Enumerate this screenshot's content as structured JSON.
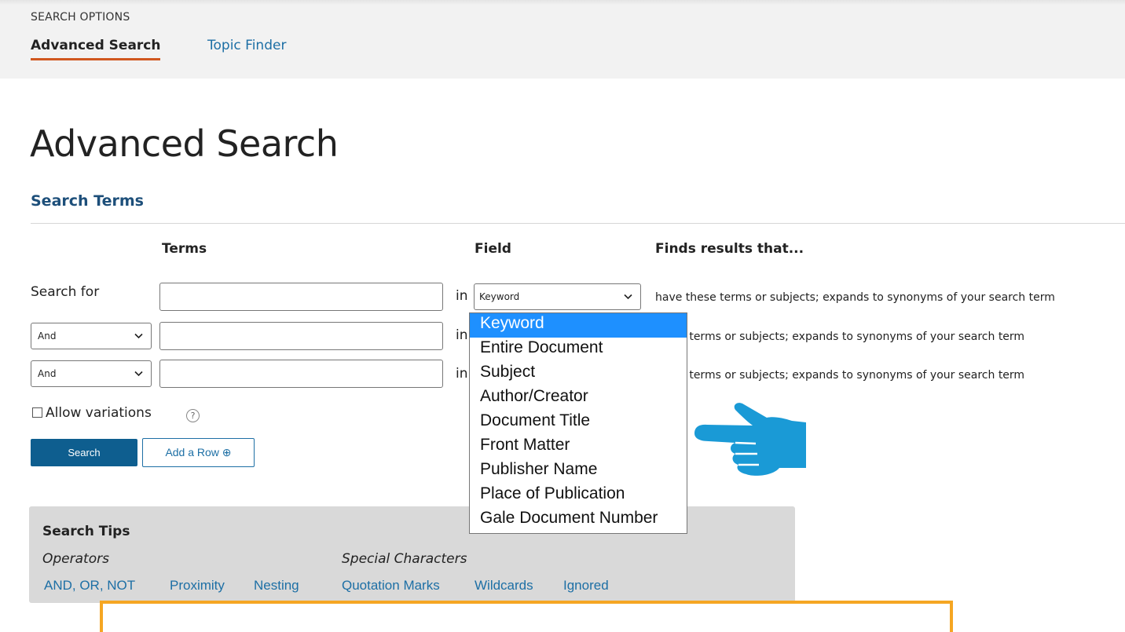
{
  "search_options": {
    "label": "SEARCH OPTIONS",
    "tabs": [
      {
        "label": "Advanced Search",
        "active": true
      },
      {
        "label": "Topic Finder",
        "active": false
      }
    ]
  },
  "page_title": "Advanced Search",
  "section_title": "Search Terms",
  "columns": {
    "terms": "Terms",
    "field": "Field",
    "finds": "Finds results that..."
  },
  "rows": [
    {
      "label": "Search for",
      "term_value": "",
      "in": "in",
      "field": "Keyword",
      "finds": "have these terms or subjects; expands to synonyms of your search term"
    },
    {
      "operator": "And",
      "term_value": "",
      "in": "in",
      "finds": "these terms or subjects; expands to synonyms of your search term"
    },
    {
      "operator": "And",
      "term_value": "",
      "in": "in",
      "finds": "these terms or subjects; expands to synonyms of your search term"
    }
  ],
  "field_options": [
    "Keyword",
    "Entire Document",
    "Subject",
    "Author/Creator",
    "Document Title",
    "Front Matter",
    "Publisher Name",
    "Place of Publication",
    "Gale Document Number"
  ],
  "selected_field_index": 0,
  "allow_variations": {
    "label": "Allow variations",
    "checked": false,
    "help_icon": "?"
  },
  "buttons": {
    "search": "Search",
    "add_row": "Add a Row ⊕"
  },
  "tips": {
    "title": "Search Tips",
    "operators_label": "Operators",
    "special_label": "Special Characters",
    "operator_links": [
      "AND, OR, NOT",
      "Proximity",
      "Nesting"
    ],
    "special_links": [
      "Quotation Marks",
      "Wildcards",
      "Ignored"
    ]
  },
  "colors": {
    "accent_tab": "#d0571f",
    "link": "#1d6fa5",
    "button": "#0e5e8f",
    "dropdown_highlight": "#1e90ff",
    "hand": "#1a9ad6",
    "frame": "#f5a623"
  },
  "icons": {
    "hand": "pointing-hand-icon",
    "chevron": "chevron-down-icon",
    "help": "help-circle-icon"
  }
}
